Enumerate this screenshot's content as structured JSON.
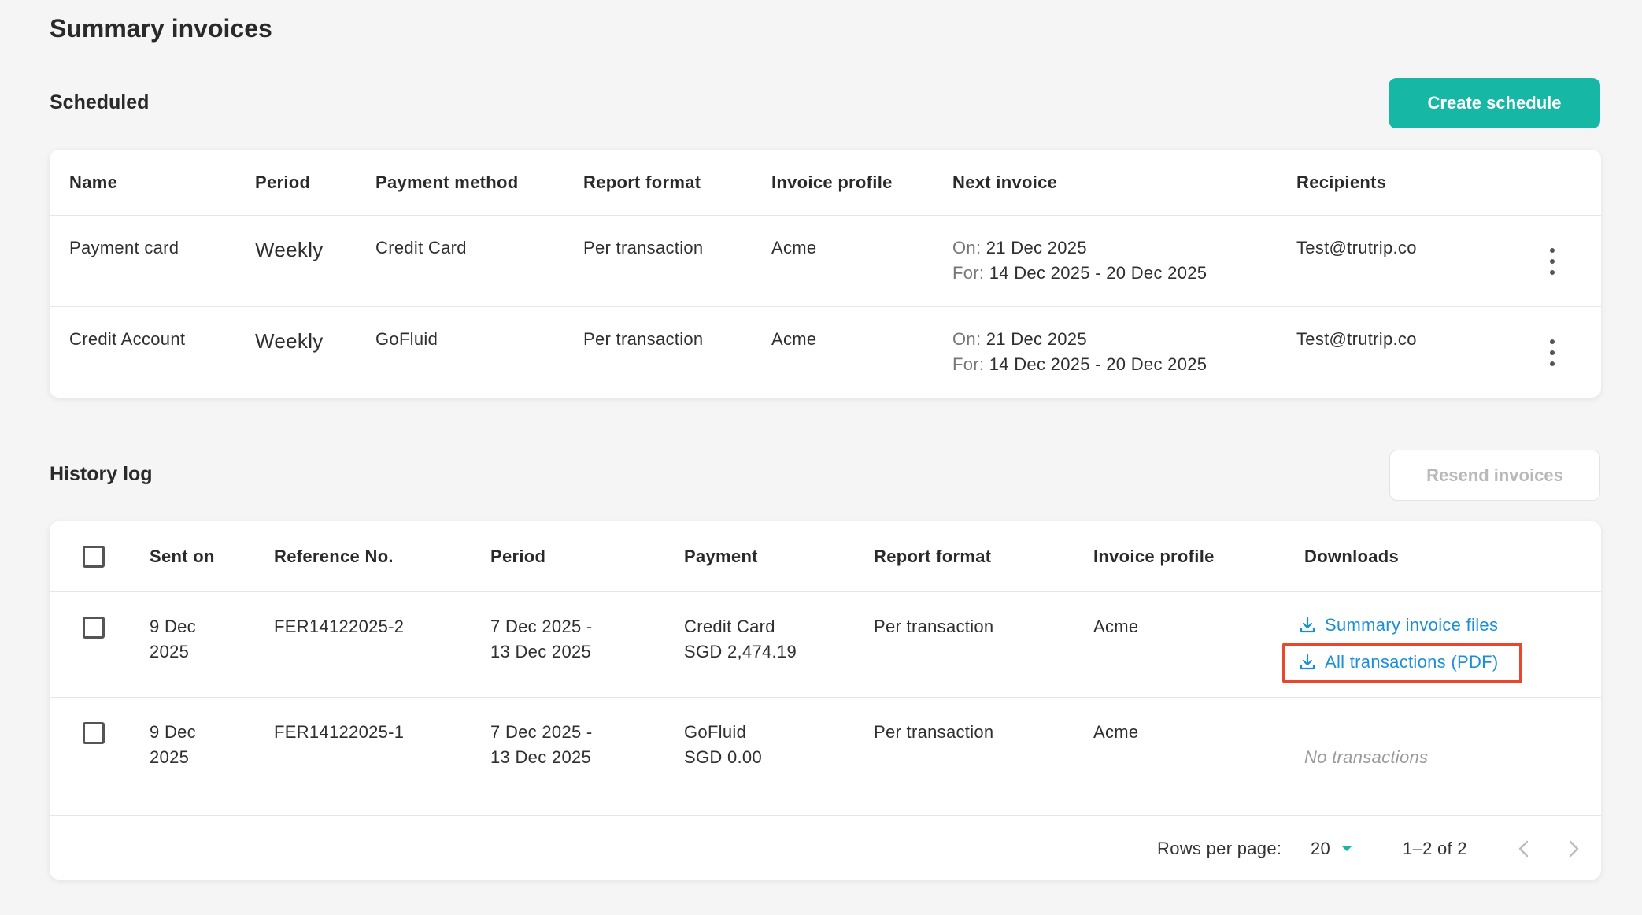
{
  "page": {
    "title": "Summary invoices"
  },
  "scheduled": {
    "title": "Scheduled",
    "create_button": "Create schedule",
    "columns": [
      "Name",
      "Period",
      "Payment method",
      "Report format",
      "Invoice profile",
      "Next invoice",
      "Recipients"
    ],
    "rows": [
      {
        "name": "Payment card",
        "period": "Weekly",
        "payment_method": "Credit Card",
        "report_format": "Per transaction",
        "invoice_profile": "Acme",
        "on_label": "On:",
        "on_value": "21 Dec 2025",
        "for_label": "For:",
        "for_value": "14 Dec 2025 - 20 Dec 2025",
        "recipients": "Test@trutrip.co"
      },
      {
        "name": "Credit Account",
        "period": "Weekly",
        "payment_method": "GoFluid",
        "report_format": "Per transaction",
        "invoice_profile": "Acme",
        "on_label": "On:",
        "on_value": "21 Dec 2025",
        "for_label": "For:",
        "for_value": "14 Dec 2025 - 20 Dec 2025",
        "recipients": "Test@trutrip.co"
      }
    ]
  },
  "history": {
    "title": "History log",
    "resend_button": "Resend invoices",
    "columns": [
      "Sent on",
      "Reference No.",
      "Period",
      "Payment",
      "Report format",
      "Invoice profile",
      "Downloads"
    ],
    "rows": [
      {
        "sent_on_1": "9 Dec",
        "sent_on_2": "2025",
        "reference": "FER14122025-2",
        "period_1": "7 Dec 2025 -",
        "period_2": "13 Dec 2025",
        "payment_1": "Credit Card",
        "payment_2": "SGD 2,474.19",
        "report_format": "Per transaction",
        "invoice_profile": "Acme",
        "download_1": "Summary invoice files",
        "download_2": "All transactions (PDF)"
      },
      {
        "sent_on_1": "9 Dec",
        "sent_on_2": "2025",
        "reference": "FER14122025-1",
        "period_1": "7 Dec 2025 -",
        "period_2": "13 Dec 2025",
        "payment_1": "GoFluid",
        "payment_2": "SGD 0.00",
        "report_format": "Per transaction",
        "invoice_profile": "Acme",
        "no_transactions": "No transactions"
      }
    ],
    "pagination": {
      "rows_per_page_label": "Rows per page:",
      "rows_per_page_value": "20",
      "range": "1–2 of 2"
    }
  },
  "colors": {
    "primary": "#16b8a5",
    "link": "#1a8fd8",
    "highlight": "#e8462d"
  }
}
